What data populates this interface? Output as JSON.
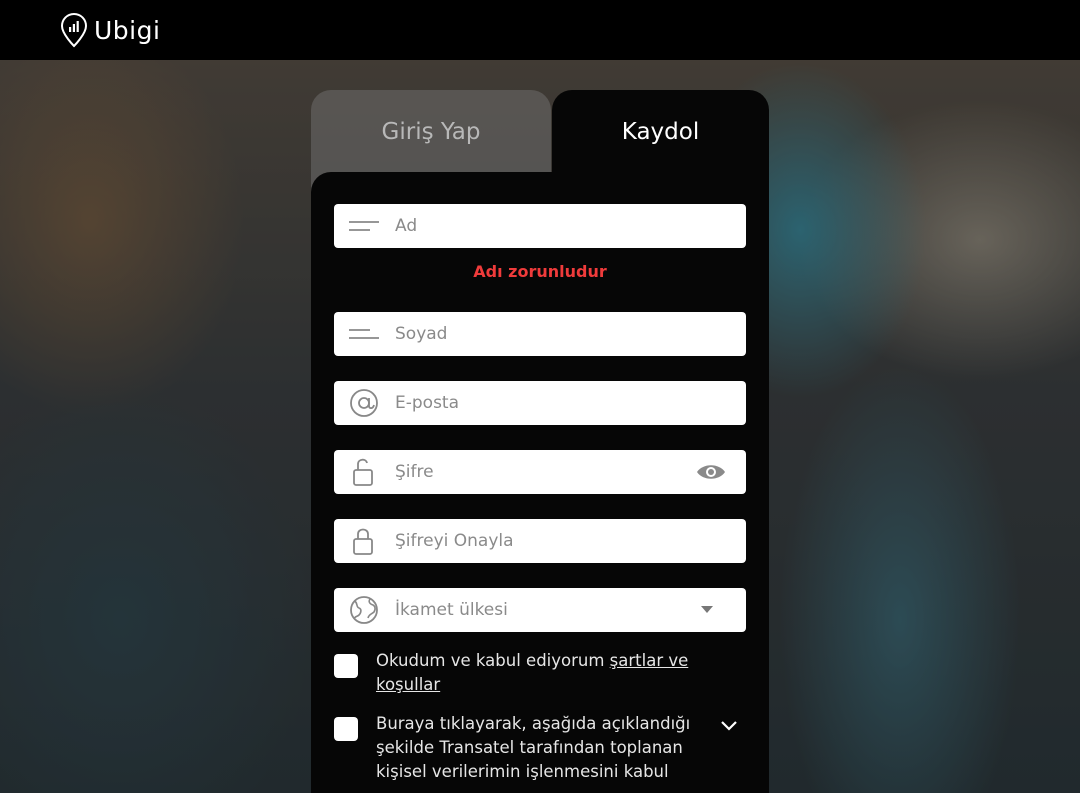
{
  "brand": {
    "name": "Ubigi"
  },
  "tabs": {
    "login": "Giriş Yap",
    "signup": "Kaydol"
  },
  "form": {
    "first_name": {
      "placeholder": "Ad",
      "error": "Adı zorunludur"
    },
    "last_name": {
      "placeholder": "Soyad"
    },
    "email": {
      "placeholder": "E-posta"
    },
    "password": {
      "placeholder": "Şifre"
    },
    "confirm_password": {
      "placeholder": "Şifreyi Onayla"
    },
    "country": {
      "placeholder": "İkamet ülkesi"
    },
    "terms": {
      "text": "Okudum ve kabul ediyorum ",
      "link": "şartlar ve koşullar"
    },
    "consent": {
      "text": "Buraya tıklayarak, aşağıda açıklandığı şekilde Transatel tarafından toplanan kişisel verilerimin işlenmesini kabul"
    }
  },
  "colors": {
    "error": "#ef3b3b",
    "panel": "#060606",
    "topbar": "#000000"
  }
}
